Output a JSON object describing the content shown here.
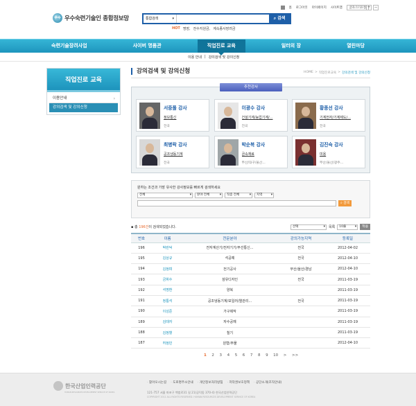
{
  "util": {
    "links": [
      "홈",
      "로그아웃",
      "마이페이지",
      "사이트맵"
    ],
    "sitemap_box": "글자크기조절",
    "font_plus": "+",
    "font_minus": "−"
  },
  "logo": {
    "mark": "우수",
    "text": "우수숙련기술인 종합정보망"
  },
  "search": {
    "select": "통합검색",
    "button": "검색",
    "icon": "search-icon"
  },
  "hot": {
    "label": "HOT",
    "terms": [
      "명장,",
      "전수지원금,",
      "계속종사장려금"
    ]
  },
  "gnb": {
    "items": [
      "숙련기술장려사업",
      "사이버 명품관",
      "직업진로 교육",
      "일터의 장",
      "열린마당"
    ],
    "active": 2
  },
  "subnav": [
    "이용 안내",
    "|",
    "강의검색 및 강의신청"
  ],
  "lnb": {
    "title": "직업진로 교육",
    "items": [
      "이용안내",
      "강의검색 및 강의신청"
    ],
    "active": 1
  },
  "page": {
    "title": "강의검색 및 강의신청",
    "breadcrumb": [
      "HOME",
      ">",
      "직업진로교육",
      ">",
      "강의검색 및 강의신청"
    ]
  },
  "recommend": {
    "tab": "추천강사",
    "cards": [
      {
        "name": "서중풀 강사",
        "field": "정보통신",
        "region": "전국"
      },
      {
        "name": "이광수 강사",
        "field": "건설기계/농업기계/...",
        "region": "전국"
      },
      {
        "name": "황종선 강사",
        "field": "기계전자/기계제도/...",
        "region": "전국"
      },
      {
        "name": "최병락 강사",
        "field": "공조냉동기계",
        "region": "전국"
      },
      {
        "name": "박순복 강사",
        "field": "금속재료",
        "region": "부산/대구/울산..."
      },
      {
        "name": "김진숙 강사",
        "field": "미용",
        "region": "부산/울산/광주..."
      }
    ]
  },
  "filter": {
    "title": "원하는 조건과 가장 유사한 강사정보를 빠르게 검색하세요",
    "selects": [
      "전체",
      "분야 전체",
      "직종 전체",
      "지역"
    ],
    "button": "검색"
  },
  "result": {
    "prefix": "총",
    "count": "196건",
    "suffix": "이 검색되었습니다.",
    "select": "선택",
    "sort_label": "목록",
    "page_size": "10줄",
    "view_btn": "적용"
  },
  "table": {
    "headers": [
      "번호",
      "이름",
      "전문분야",
      "강의가능지역",
      "등록일"
    ],
    "rows": [
      [
        "196",
        "박란덕",
        "전자계산기/전자기기/무선통신...",
        "전국",
        "2012-04-02"
      ],
      [
        "195",
        "김상규",
        "석공예",
        "전국",
        "2012-04-10"
      ],
      [
        "194",
        "김정며",
        "전기공사",
        "부산/울산/경남",
        "2012-04-10"
      ],
      [
        "193",
        "금휘수",
        "섬유디자인",
        "전국",
        "2011-03-19"
      ],
      [
        "192",
        "석명환",
        "양복",
        "",
        "2011-03-19"
      ],
      [
        "191",
        "정통석",
        "공조냉동기계/보일러/열관리...",
        "전국",
        "2011-03-19"
      ],
      [
        "190",
        "이성준",
        "가구제작",
        "",
        "2011-03-19"
      ],
      [
        "189",
        "김태자",
        "자수공예",
        "",
        "2011-03-19"
      ],
      [
        "188",
        "김정혈",
        "칠기",
        "",
        "2011-03-19"
      ],
      [
        "187",
        "허정민",
        "원형/주물",
        "",
        "2012-04-10"
      ]
    ]
  },
  "paging": [
    "1",
    "2",
    "3",
    "4",
    "5",
    "6",
    "7",
    "8",
    "9",
    "10",
    ">",
    ">>"
  ],
  "footer": {
    "logo": "한국산업인력공단",
    "logo_sub": "HUMAN RESOURCES DEVELOPMENT SERVICE OF KOREA",
    "links": [
      "찾아오시는길",
      "도로명주소안내",
      "개인정보처리방침",
      "저작권보호정책",
      "공단소개(조직안내)"
    ],
    "address": "121-757 서울 마포구 백범로31 길 21(공덕동 370-4) 한국산업인력공단",
    "copyright": "COPYRIGHT 2011 ALL RIGHTS RESERVED. HUMAN RESOURCES DEVELOPMENT SERVICE OF KOREA"
  }
}
